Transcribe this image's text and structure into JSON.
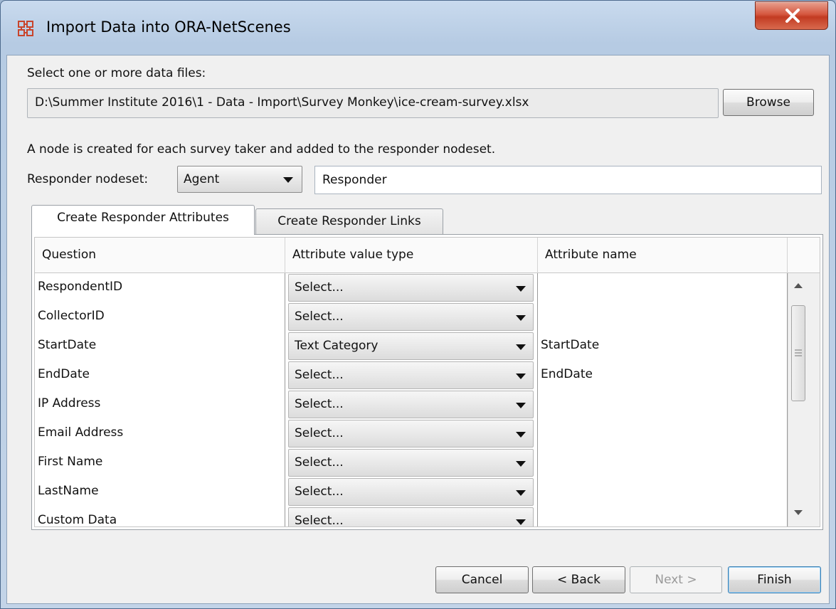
{
  "window": {
    "title": "Import Data into ORA-NetScenes",
    "icon": "ora-network-icon"
  },
  "file_section": {
    "label": "Select one or more data files:",
    "path": "D:\\Summer Institute 2016\\1 - Data - Import\\Survey Monkey\\ice-cream-survey.xlsx",
    "browse_label": "Browse"
  },
  "responder": {
    "description": "A node is created for each survey taker and added to the responder nodeset.",
    "nodeset_label": "Responder nodeset:",
    "nodeset_value": "Agent",
    "name_value": "Responder"
  },
  "tabs": [
    {
      "label": "Create Responder Attributes",
      "active": true
    },
    {
      "label": "Create Responder Links",
      "active": false
    }
  ],
  "table": {
    "headers": [
      "Question",
      "Attribute value type",
      "Attribute name"
    ],
    "rows": [
      {
        "question": "RespondentID",
        "type": "Select...",
        "name": ""
      },
      {
        "question": "CollectorID",
        "type": "Select...",
        "name": ""
      },
      {
        "question": "StartDate",
        "type": "Text Category",
        "name": "StartDate"
      },
      {
        "question": "EndDate",
        "type": "Select...",
        "name": "EndDate"
      },
      {
        "question": "IP Address",
        "type": "Select...",
        "name": ""
      },
      {
        "question": "Email Address",
        "type": "Select...",
        "name": ""
      },
      {
        "question": "First Name",
        "type": "Select...",
        "name": ""
      },
      {
        "question": "LastName",
        "type": "Select...",
        "name": ""
      },
      {
        "question": "Custom Data",
        "type": "Select...",
        "name": ""
      }
    ]
  },
  "buttons": {
    "cancel": "Cancel",
    "back": "< Back",
    "next": "Next >",
    "finish": "Finish"
  },
  "colors": {
    "close_button": "#c9442b",
    "default_button_border": "#3c7fb1"
  }
}
